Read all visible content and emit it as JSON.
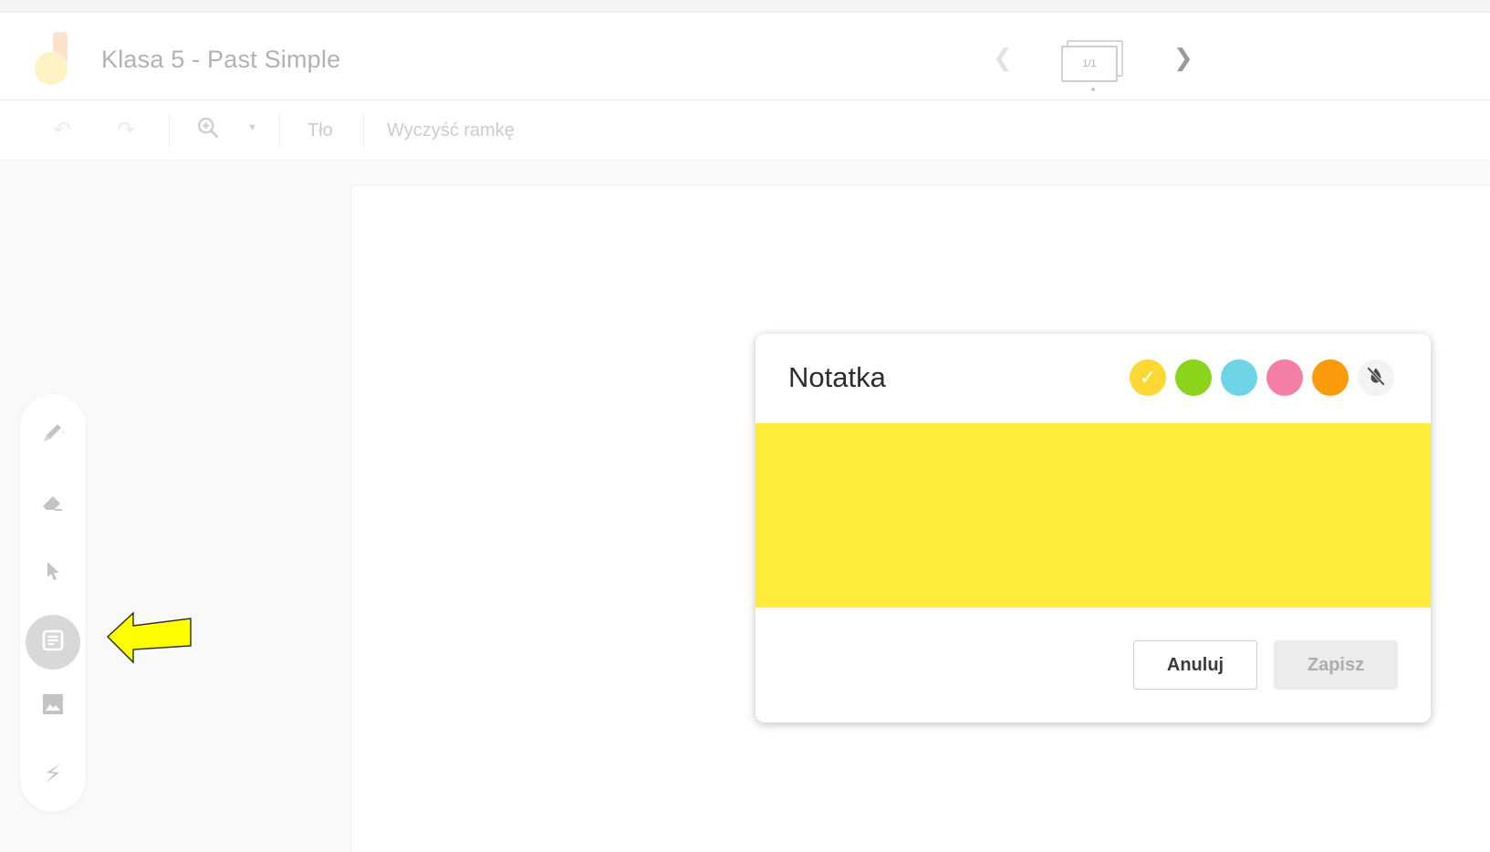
{
  "app": {
    "title": "Klasa 5 - Past Simple"
  },
  "pager": {
    "page_indicator": "1/1"
  },
  "toolbar": {
    "undo_icon": "undo-icon",
    "redo_icon": "redo-icon",
    "zoom_icon": "zoom-in-icon",
    "background_label": "Tło",
    "clear_frame_label": "Wyczyść ramkę"
  },
  "side_tools": [
    {
      "name": "pen-tool",
      "icon": "pen-icon"
    },
    {
      "name": "eraser-tool",
      "icon": "eraser-icon"
    },
    {
      "name": "select-tool",
      "icon": "cursor-icon"
    },
    {
      "name": "sticky-note-tool",
      "icon": "sticky-note-icon",
      "active": true
    },
    {
      "name": "image-tool",
      "icon": "image-icon"
    },
    {
      "name": "laser-tool",
      "icon": "laser-icon"
    }
  ],
  "dialog": {
    "title": "Notatka",
    "colors": [
      {
        "name": "yellow",
        "hex": "#fdd835",
        "selected": true
      },
      {
        "name": "green",
        "hex": "#8bd41b"
      },
      {
        "name": "blue",
        "hex": "#6dd5e6"
      },
      {
        "name": "pink",
        "hex": "#f57ea5"
      },
      {
        "name": "orange",
        "hex": "#fb9b0b"
      }
    ],
    "note_color": "#ffeb3b",
    "cancel_label": "Anuluj",
    "save_label": "Zapisz"
  },
  "annotation": {
    "arrow_color": "#ffff00"
  }
}
